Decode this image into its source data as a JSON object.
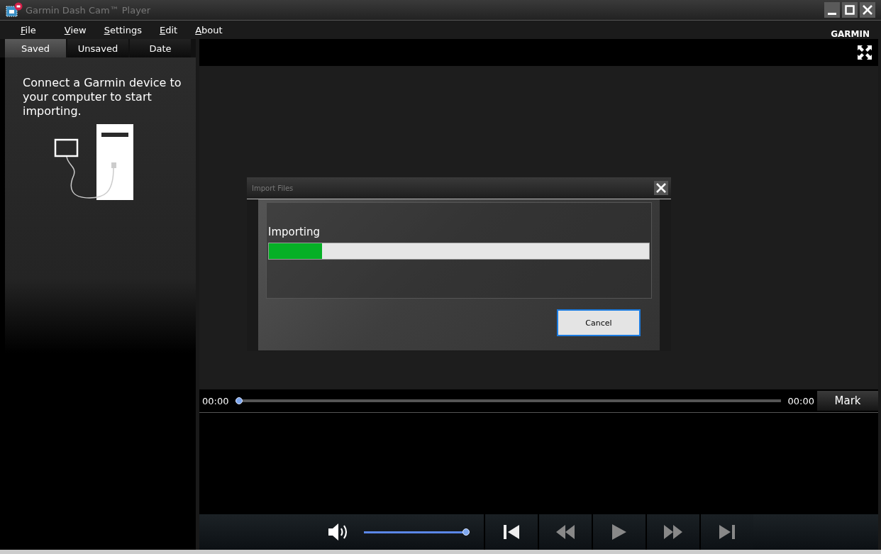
{
  "window": {
    "title": "Garmin Dash Cam™ Player"
  },
  "menu": [
    {
      "label": "File"
    },
    {
      "label": "View"
    },
    {
      "label": "Settings"
    },
    {
      "label": "Edit"
    },
    {
      "label": "About"
    }
  ],
  "brand": "GARMIN",
  "tabs": [
    {
      "label": "Saved",
      "selected": true
    },
    {
      "label": "Unsaved",
      "selected": false
    },
    {
      "label": "Date",
      "selected": false
    }
  ],
  "sidebar": {
    "message": "Connect a Garmin device to your computer to start importing."
  },
  "dialog": {
    "title": "Import Files",
    "status": "Importing",
    "progress": {
      "level": 0.14
    },
    "button": "Cancel"
  },
  "timeline": {
    "start": "00:00",
    "end": "00:00",
    "level": 0,
    "mark_button": "Mark"
  },
  "volume": {
    "level": 1
  }
}
